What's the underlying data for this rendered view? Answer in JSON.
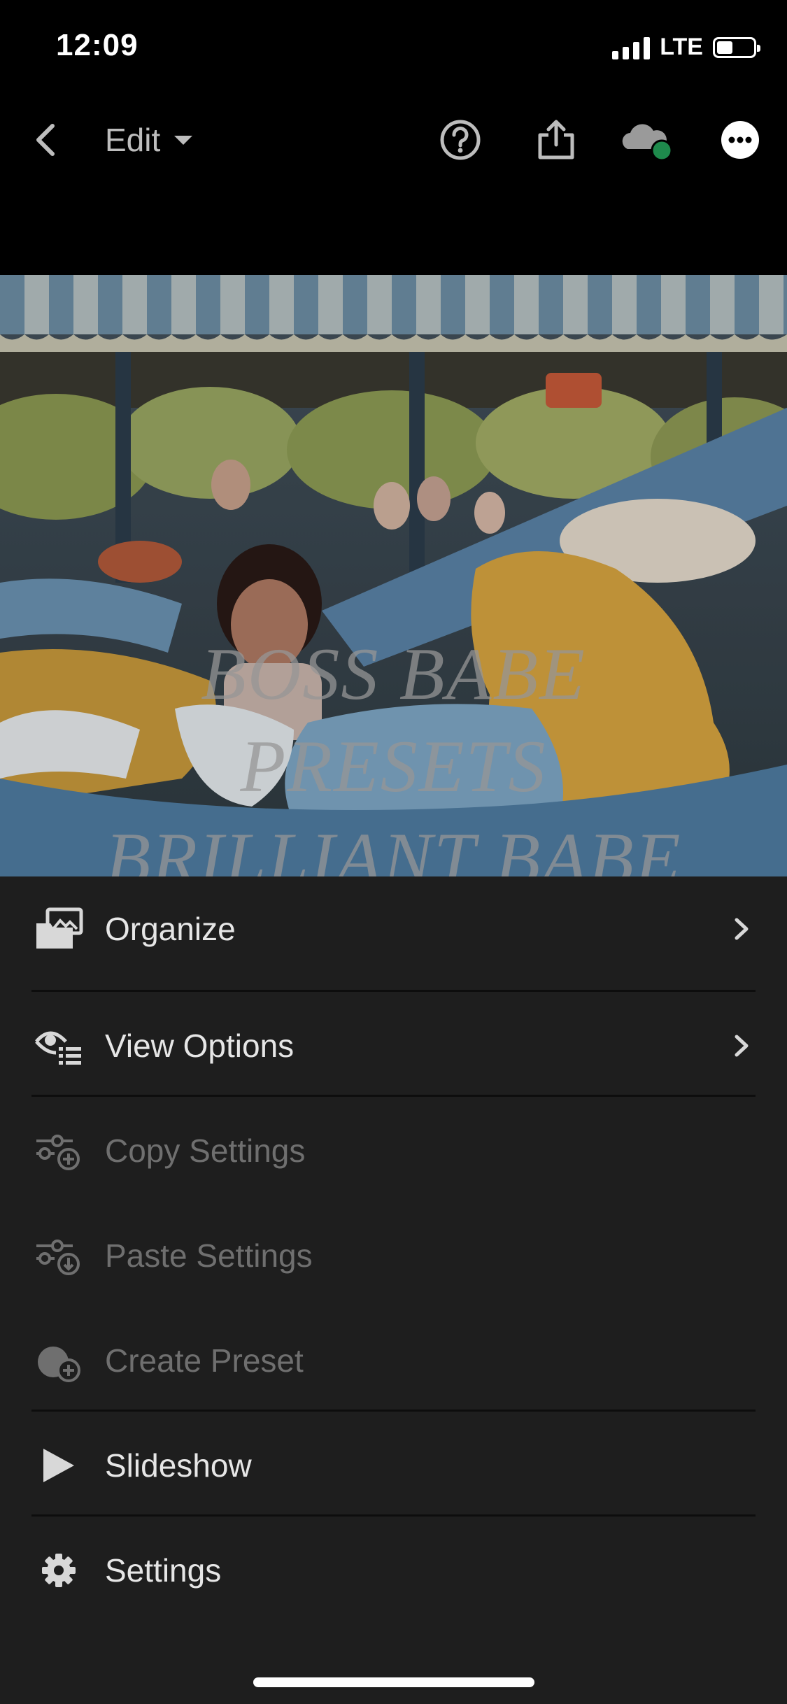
{
  "status_bar": {
    "time": "12:09",
    "network": "LTE"
  },
  "toolbar": {
    "edit_label": "Edit",
    "icons": [
      "back-chevron-icon",
      "dropdown-caret-icon",
      "help-icon",
      "share-icon",
      "cloud-sync-icon",
      "more-icon"
    ],
    "sync_status_color": "#1e8a4c"
  },
  "photo": {
    "watermark_lines": [
      "BOSS BABE",
      "PRESETS",
      "BRILLIANT BABE"
    ]
  },
  "menu": {
    "items": [
      {
        "label": "Organize",
        "icon": "organize-icon",
        "enabled": true,
        "has_submenu": true
      },
      {
        "label": "View Options",
        "icon": "view-options-icon",
        "enabled": true,
        "has_submenu": true
      },
      {
        "label": "Copy Settings",
        "icon": "copy-settings-icon",
        "enabled": false,
        "has_submenu": false
      },
      {
        "label": "Paste Settings",
        "icon": "paste-settings-icon",
        "enabled": false,
        "has_submenu": false
      },
      {
        "label": "Create Preset",
        "icon": "create-preset-icon",
        "enabled": false,
        "has_submenu": false
      },
      {
        "label": "Slideshow",
        "icon": "play-icon",
        "enabled": true,
        "has_submenu": false
      },
      {
        "label": "Settings",
        "icon": "gear-icon",
        "enabled": true,
        "has_submenu": false
      }
    ]
  },
  "colors": {
    "menu_background": "#1e1e1e",
    "enabled_text": "#e6e6e6",
    "disabled_text": "#6f6f6f"
  }
}
